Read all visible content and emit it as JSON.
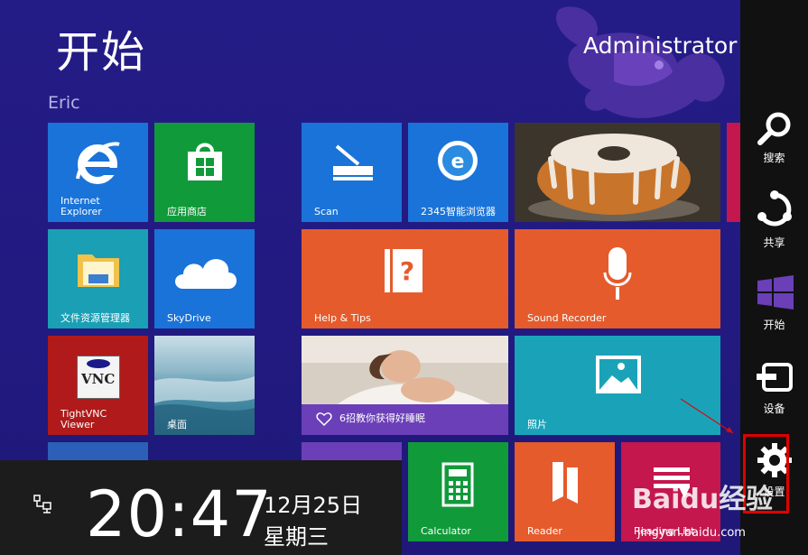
{
  "start": {
    "title": "开始",
    "user": "Administrator",
    "group_label": "Eric"
  },
  "tiles": {
    "ie": "Internet\nExplorer",
    "store": "应用商店",
    "explorer": "文件资源管理器",
    "skydrive": "SkyDrive",
    "tightvnc": "TightVNC\nViewer",
    "desktop": "桌面",
    "scan": "Scan",
    "browser2345": "2345智能浏览器",
    "help": "Help & Tips",
    "sound": "Sound Recorder",
    "sleep": "6招教你获得好睡眠",
    "photos": "照片",
    "calculator": "Calculator",
    "reader": "Reader",
    "reading_list": "Reading List",
    "vnc_badge": "VNC"
  },
  "charms": [
    {
      "label": "搜索",
      "icon": "search-icon"
    },
    {
      "label": "共享",
      "icon": "share-icon"
    },
    {
      "label": "开始",
      "icon": "windows-logo-icon"
    },
    {
      "label": "设备",
      "icon": "devices-icon"
    },
    {
      "label": "设置",
      "icon": "settings-gear-icon"
    }
  ],
  "clock": {
    "time": "20:47",
    "date": "12月25日",
    "weekday": "星期三"
  },
  "watermark": {
    "brand": "Baidu经验",
    "url": "jingyan.baidu.com"
  },
  "colors": {
    "background": "#241c86",
    "charm_bar": "#111111",
    "highlight": "#e00000"
  }
}
